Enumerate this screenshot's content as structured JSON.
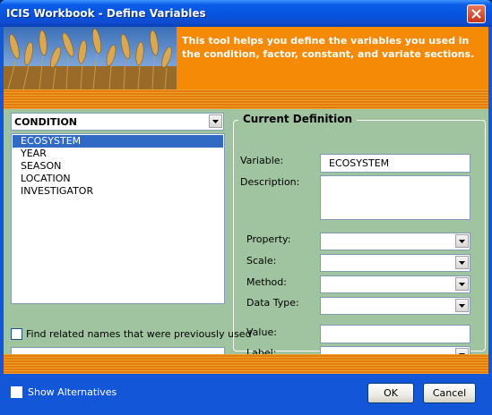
{
  "window": {
    "title": "ICIS Workbook - Define Variables"
  },
  "banner": {
    "text": "This tool helps you define the variables you used in the condition, factor, constant, and variate sections."
  },
  "left": {
    "section_combo_value": "CONDITION",
    "items": [
      "ECOSYSTEM",
      "YEAR",
      "SEASON",
      "LOCATION",
      "INVESTIGATOR"
    ],
    "selected_index": 0,
    "find_related_label": "Find related names that were previously used",
    "find_related_checked": false,
    "find_input_value": ""
  },
  "definition": {
    "title": "Current Definition",
    "variable_label": "Variable:",
    "variable_value": "ECOSYSTEM",
    "description_label": "Description:",
    "description_value": "",
    "property_label": "Property:",
    "scale_label": "Scale:",
    "method_label": "Method:",
    "datatype_label": "Data Type:",
    "value_label": "Value:",
    "label_label": "Label:"
  },
  "footer": {
    "show_alternatives_label": "Show Alternatives",
    "show_alternatives_checked": false,
    "ok_label": "OK",
    "cancel_label": "Cancel"
  },
  "colors": {
    "title_bar": "#0553e0",
    "banner_orange": "#f58a06",
    "panel_green": "#a0c4a0",
    "selection_blue": "#316ac5",
    "footer_blue": "#1456d8"
  },
  "icons": {
    "close": "close-icon",
    "dropdown": "chevron-down-icon",
    "banner": "wheat-field-image"
  }
}
